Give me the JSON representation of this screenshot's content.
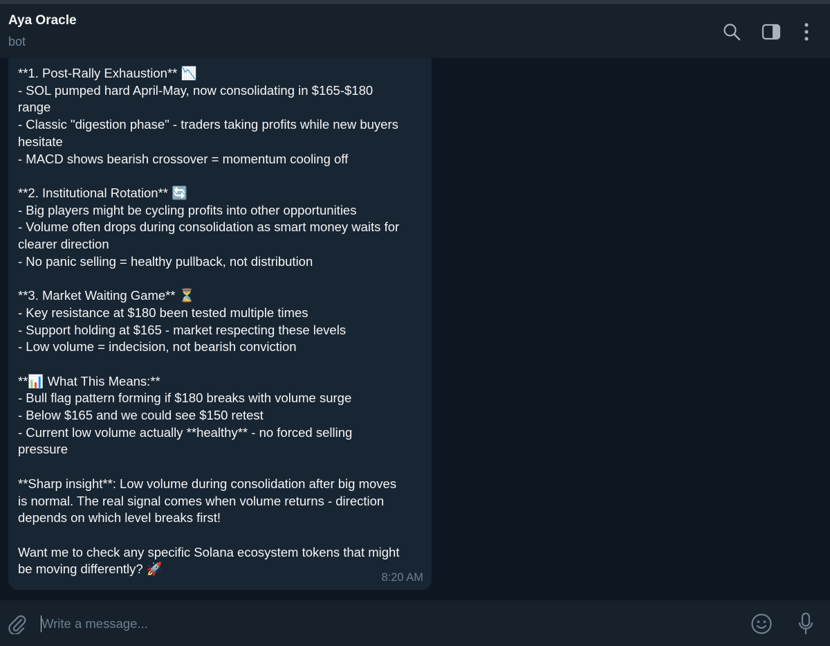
{
  "header": {
    "title": "Aya Oracle",
    "subtitle": "bot",
    "icons": [
      "search-icon",
      "side-panel-icon",
      "more-vertical-icon"
    ]
  },
  "message": {
    "lines": [
      "**1. Post-Rally Exhaustion** 📉",
      "- SOL pumped hard April-May, now consolidating in $165-$180",
      "range",
      "- Classic \"digestion phase\" - traders taking profits while new buyers",
      "hesitate",
      "- MACD shows bearish crossover = momentum cooling off",
      "",
      "**2. Institutional Rotation** 🔄",
      "- Big players might be cycling profits into other opportunities",
      "- Volume often drops during consolidation as smart money waits for",
      "clearer direction",
      "- No panic selling = healthy pullback, not distribution",
      "",
      "**3. Market Waiting Game** ⏳",
      "- Key resistance at $180 been tested multiple times",
      "- Support holding at $165 - market respecting these levels",
      "- Low volume = indecision, not bearish conviction",
      "",
      "**📊 What This Means:**",
      "- Bull flag pattern forming if $180 breaks with volume surge",
      "- Below $165 and we could see $150 retest",
      "- Current low volume actually **healthy** - no forced selling",
      "pressure",
      "",
      "**Sharp insight**: Low volume during consolidation after big moves",
      "is normal. The real signal comes when volume returns - direction",
      "depends on which level breaks first!",
      "",
      "Want me to check any specific Solana ecosystem tokens that might",
      "be moving differently? 🚀"
    ],
    "time": "8:20 AM"
  },
  "composer": {
    "placeholder": "Write a message...",
    "icons": [
      "attach-icon",
      "emoji-icon",
      "microphone-icon"
    ]
  },
  "colors": {
    "background": "#0e1621",
    "header": "#17212b",
    "bubble": "#182533",
    "muted": "#708499"
  }
}
